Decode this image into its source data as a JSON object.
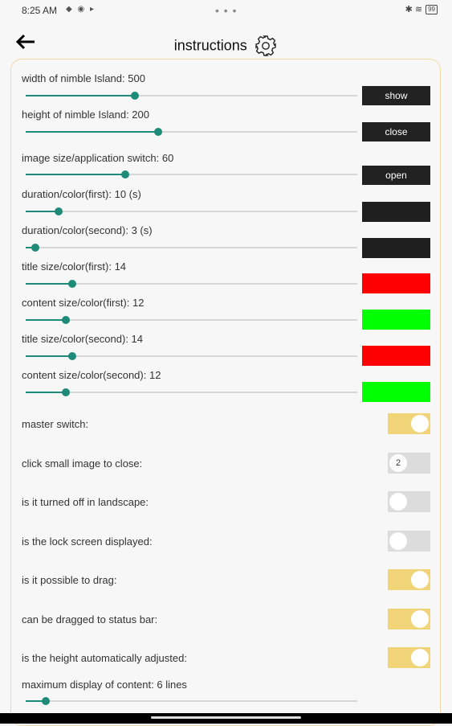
{
  "status": {
    "time": "8:25 AM",
    "dots": "• • •",
    "battery": "99",
    "left_icons": "◆ ◉ ▸",
    "right_icons": "✱ ≋"
  },
  "header": {
    "title": "instructions"
  },
  "sliders": [
    {
      "label": "width of nimble Island:  500",
      "value": 0.33
    },
    {
      "label": "height of nimble Island:  200",
      "value": 0.4
    },
    {
      "label": "image size/application switch:  60",
      "value": 0.3
    },
    {
      "label": "duration/color(first):  10 (s)",
      "value": 0.1
    },
    {
      "label": "duration/color(second):  3 (s)",
      "value": 0.03
    },
    {
      "label": "title size/color(first):  14",
      "value": 0.14
    },
    {
      "label": "content size/color(first):  12",
      "value": 0.12
    },
    {
      "label": "title size/color(second):  14",
      "value": 0.14
    },
    {
      "label": "content size/color(second):  12",
      "value": 0.12
    }
  ],
  "buttons": {
    "show": "show",
    "close": "close",
    "open": "open"
  },
  "colors": {
    "first_duration": "#1f1f1f",
    "second_duration": "#1f1f1f",
    "title_first": "#ff0000",
    "content_first": "#00ff00",
    "title_second": "#ff0000",
    "content_second": "#00ff00",
    "switch_on": "#f1d478",
    "switch_off": "#dcdcdc",
    "accent": "#1e8a78"
  },
  "toggles": [
    {
      "label": "master switch:",
      "on": true,
      "knob_text": ""
    },
    {
      "label": "click small image to close:",
      "on": false,
      "knob_text": "2"
    },
    {
      "label": "is it turned off in landscape:",
      "on": false,
      "knob_text": ""
    },
    {
      "label": "is the lock screen displayed:",
      "on": false,
      "knob_text": ""
    },
    {
      "label": "is it possible to drag:",
      "on": true,
      "knob_text": ""
    },
    {
      "label": "can be dragged to status bar:",
      "on": true,
      "knob_text": ""
    },
    {
      "label": "is the height automatically adjusted:",
      "on": true,
      "knob_text": ""
    }
  ],
  "max_lines": {
    "label": "maximum display of content:  6 lines",
    "value": 0.06
  }
}
